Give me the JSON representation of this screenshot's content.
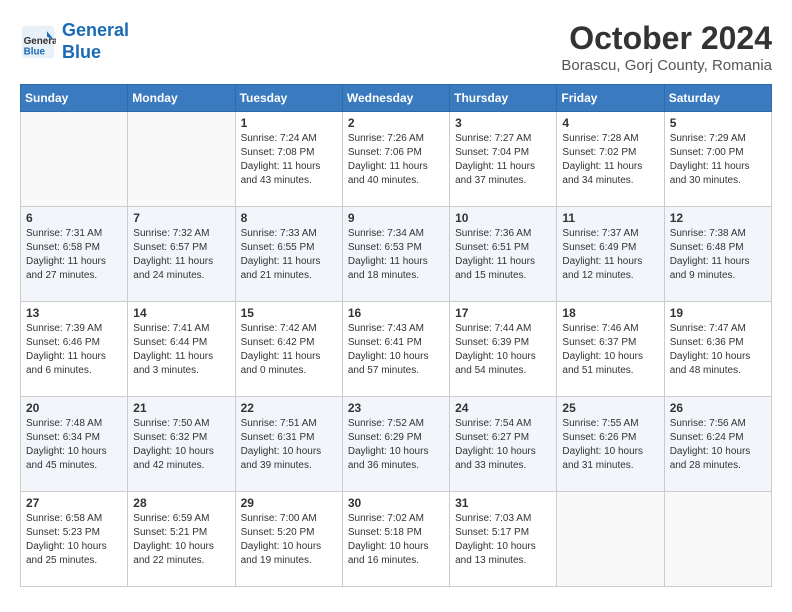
{
  "header": {
    "logo_line1": "General",
    "logo_line2": "Blue",
    "month": "October 2024",
    "location": "Borascu, Gorj County, Romania"
  },
  "weekdays": [
    "Sunday",
    "Monday",
    "Tuesday",
    "Wednesday",
    "Thursday",
    "Friday",
    "Saturday"
  ],
  "weeks": [
    [
      {
        "day": "",
        "info": ""
      },
      {
        "day": "",
        "info": ""
      },
      {
        "day": "1",
        "info": "Sunrise: 7:24 AM\nSunset: 7:08 PM\nDaylight: 11 hours and 43 minutes."
      },
      {
        "day": "2",
        "info": "Sunrise: 7:26 AM\nSunset: 7:06 PM\nDaylight: 11 hours and 40 minutes."
      },
      {
        "day": "3",
        "info": "Sunrise: 7:27 AM\nSunset: 7:04 PM\nDaylight: 11 hours and 37 minutes."
      },
      {
        "day": "4",
        "info": "Sunrise: 7:28 AM\nSunset: 7:02 PM\nDaylight: 11 hours and 34 minutes."
      },
      {
        "day": "5",
        "info": "Sunrise: 7:29 AM\nSunset: 7:00 PM\nDaylight: 11 hours and 30 minutes."
      }
    ],
    [
      {
        "day": "6",
        "info": "Sunrise: 7:31 AM\nSunset: 6:58 PM\nDaylight: 11 hours and 27 minutes."
      },
      {
        "day": "7",
        "info": "Sunrise: 7:32 AM\nSunset: 6:57 PM\nDaylight: 11 hours and 24 minutes."
      },
      {
        "day": "8",
        "info": "Sunrise: 7:33 AM\nSunset: 6:55 PM\nDaylight: 11 hours and 21 minutes."
      },
      {
        "day": "9",
        "info": "Sunrise: 7:34 AM\nSunset: 6:53 PM\nDaylight: 11 hours and 18 minutes."
      },
      {
        "day": "10",
        "info": "Sunrise: 7:36 AM\nSunset: 6:51 PM\nDaylight: 11 hours and 15 minutes."
      },
      {
        "day": "11",
        "info": "Sunrise: 7:37 AM\nSunset: 6:49 PM\nDaylight: 11 hours and 12 minutes."
      },
      {
        "day": "12",
        "info": "Sunrise: 7:38 AM\nSunset: 6:48 PM\nDaylight: 11 hours and 9 minutes."
      }
    ],
    [
      {
        "day": "13",
        "info": "Sunrise: 7:39 AM\nSunset: 6:46 PM\nDaylight: 11 hours and 6 minutes."
      },
      {
        "day": "14",
        "info": "Sunrise: 7:41 AM\nSunset: 6:44 PM\nDaylight: 11 hours and 3 minutes."
      },
      {
        "day": "15",
        "info": "Sunrise: 7:42 AM\nSunset: 6:42 PM\nDaylight: 11 hours and 0 minutes."
      },
      {
        "day": "16",
        "info": "Sunrise: 7:43 AM\nSunset: 6:41 PM\nDaylight: 10 hours and 57 minutes."
      },
      {
        "day": "17",
        "info": "Sunrise: 7:44 AM\nSunset: 6:39 PM\nDaylight: 10 hours and 54 minutes."
      },
      {
        "day": "18",
        "info": "Sunrise: 7:46 AM\nSunset: 6:37 PM\nDaylight: 10 hours and 51 minutes."
      },
      {
        "day": "19",
        "info": "Sunrise: 7:47 AM\nSunset: 6:36 PM\nDaylight: 10 hours and 48 minutes."
      }
    ],
    [
      {
        "day": "20",
        "info": "Sunrise: 7:48 AM\nSunset: 6:34 PM\nDaylight: 10 hours and 45 minutes."
      },
      {
        "day": "21",
        "info": "Sunrise: 7:50 AM\nSunset: 6:32 PM\nDaylight: 10 hours and 42 minutes."
      },
      {
        "day": "22",
        "info": "Sunrise: 7:51 AM\nSunset: 6:31 PM\nDaylight: 10 hours and 39 minutes."
      },
      {
        "day": "23",
        "info": "Sunrise: 7:52 AM\nSunset: 6:29 PM\nDaylight: 10 hours and 36 minutes."
      },
      {
        "day": "24",
        "info": "Sunrise: 7:54 AM\nSunset: 6:27 PM\nDaylight: 10 hours and 33 minutes."
      },
      {
        "day": "25",
        "info": "Sunrise: 7:55 AM\nSunset: 6:26 PM\nDaylight: 10 hours and 31 minutes."
      },
      {
        "day": "26",
        "info": "Sunrise: 7:56 AM\nSunset: 6:24 PM\nDaylight: 10 hours and 28 minutes."
      }
    ],
    [
      {
        "day": "27",
        "info": "Sunrise: 6:58 AM\nSunset: 5:23 PM\nDaylight: 10 hours and 25 minutes."
      },
      {
        "day": "28",
        "info": "Sunrise: 6:59 AM\nSunset: 5:21 PM\nDaylight: 10 hours and 22 minutes."
      },
      {
        "day": "29",
        "info": "Sunrise: 7:00 AM\nSunset: 5:20 PM\nDaylight: 10 hours and 19 minutes."
      },
      {
        "day": "30",
        "info": "Sunrise: 7:02 AM\nSunset: 5:18 PM\nDaylight: 10 hours and 16 minutes."
      },
      {
        "day": "31",
        "info": "Sunrise: 7:03 AM\nSunset: 5:17 PM\nDaylight: 10 hours and 13 minutes."
      },
      {
        "day": "",
        "info": ""
      },
      {
        "day": "",
        "info": ""
      }
    ]
  ]
}
